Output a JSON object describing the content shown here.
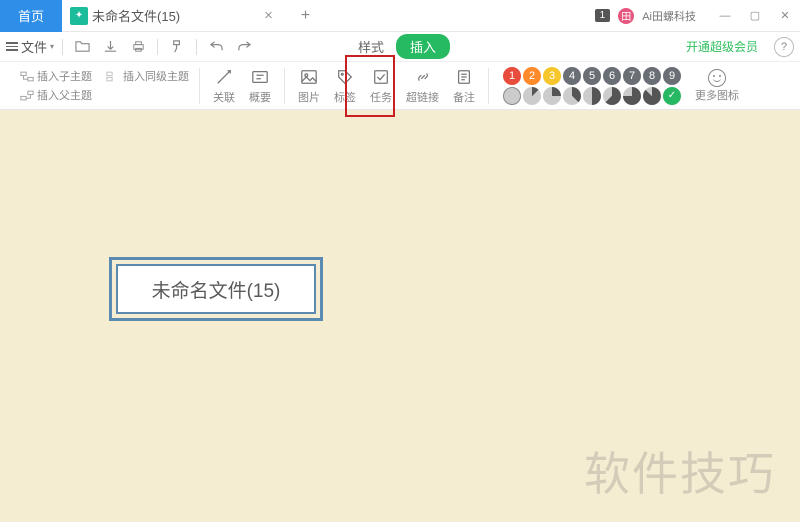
{
  "titlebar": {
    "home": "首页",
    "doc_title": "未命名文件(15)",
    "one_badge": "1",
    "user_name": "Ai田螺科技"
  },
  "filebar": {
    "file_label": "文件",
    "style_tab": "样式",
    "insert_tab": "插入",
    "vip_link": "开通超级会员",
    "help": "?"
  },
  "ribbon": {
    "insert_child": "插入子主题",
    "insert_same": "插入同级主题",
    "insert_parent": "插入父主题",
    "relate": "关联",
    "summary": "概要",
    "image": "图片",
    "tag": "标签",
    "task": "任务",
    "link": "超链接",
    "note": "备注",
    "more_icons": "更多图标",
    "badges": [
      "1",
      "2",
      "3",
      "4",
      "5",
      "6",
      "7",
      "8",
      "9"
    ],
    "badge_colors": [
      "#e74c3c",
      "#ff8a2a",
      "#f6c62b",
      "#6a6f75",
      "#6a6f75",
      "#6a6f75",
      "#6a6f75",
      "#6a6f75",
      "#6a6f75"
    ]
  },
  "node": {
    "text": "未命名文件(15)"
  },
  "watermark": "软件技巧"
}
